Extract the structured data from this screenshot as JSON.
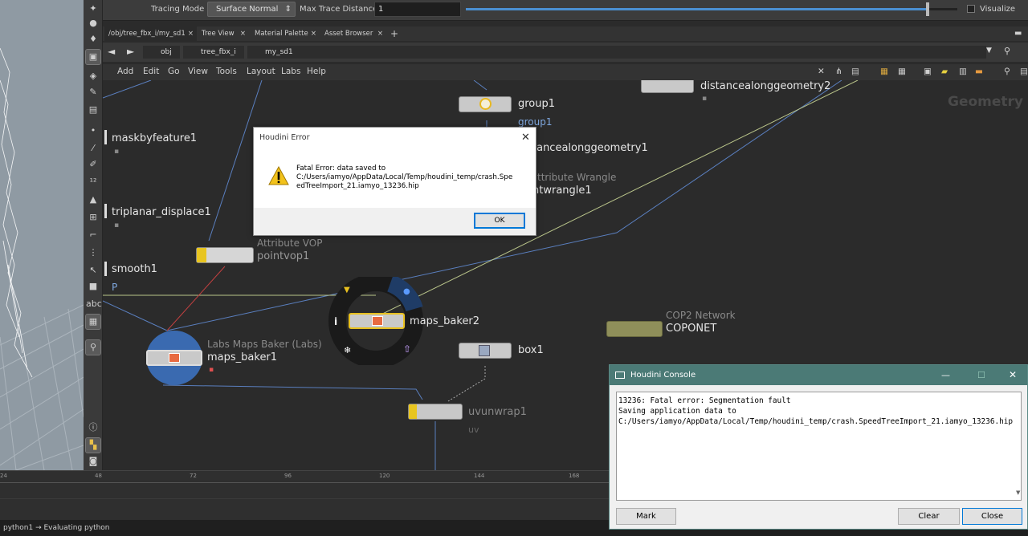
{
  "parm_bar": {
    "tracing_mode_label": "Tracing Mode",
    "tracing_mode_value": "Surface Normal",
    "max_trace_label": "Max Trace Distance",
    "max_trace_value": "1",
    "max_trace_slider_fraction": 0.94,
    "visualize_label": "Visualize"
  },
  "tabs": [
    "/obj/tree_fbx_i/my_sd1",
    "Tree View",
    "Material Palette",
    "Asset Browser"
  ],
  "path": {
    "obj": "obj",
    "tree": "tree_fbx_i",
    "sop": "my_sd1"
  },
  "menu": [
    "Add",
    "Edit",
    "Go",
    "View",
    "Tools",
    "Layout",
    "Labs",
    "Help"
  ],
  "network": {
    "context_label": "Geometry",
    "nodes": {
      "distancealonggeometry2": "distancealonggeometry2",
      "group1": "group1",
      "group1_flag": "group1",
      "distancealonggeometry1": "tancealonggeometry1",
      "attribwrangle_type": "ttribute Wrangle",
      "attribwrangle_name": "ntwrangle1",
      "maskbyfeature1": "maskbyfeature1",
      "triplanar_displace1": "triplanar_displace1",
      "pointvop_type": "Attribute VOP",
      "pointvop_name": "pointvop1",
      "smooth1": "smooth1",
      "smooth_flag": "P",
      "maps_baker2": "maps_baker2",
      "maps_baker1_type": "Labs Maps Baker (Labs)",
      "maps_baker1": "maps_baker1",
      "box1": "box1",
      "cop_type": "COP2 Network",
      "coponet": "COPONET",
      "uvunwrap1": "uvunwrap1",
      "uv_flag": "uv"
    }
  },
  "timeline": {
    "ticks": [
      "24",
      "48",
      "72",
      "96",
      "120",
      "144",
      "168"
    ]
  },
  "status_text": "python1 → Evaluating python",
  "error_dialog": {
    "title": "Houdini Error",
    "message_line1": "Fatal Error: data saved to",
    "message_line2": "C:/Users/iamyo/AppData/Local/Temp/houdini_temp/crash.Spe",
    "message_line3": "edTreeImport_21.iamyo_13236.hip",
    "ok_label": "OK"
  },
  "console": {
    "title": "Houdini Console",
    "output": "13236: Fatal error: Segmentation fault\nSaving application data to\nC:/Users/iamyo/AppData/Local/Temp/houdini_temp/crash.SpeedTreeImport_21.iamyo_13236.hip",
    "mark_label": "Mark",
    "clear_label": "Clear",
    "close_label": "Close"
  }
}
